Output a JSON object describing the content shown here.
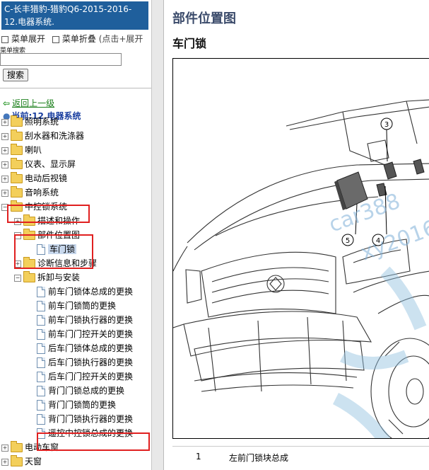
{
  "nav": {
    "title": "C-长丰猎豹-猎豹Q6-2015-2016- 12.电器系统.",
    "menu_expand": "菜单展开",
    "menu_collapse": "菜单折叠",
    "menu_hint": "(点击+展开",
    "search_label": "菜单搜索",
    "search_value": "",
    "search_button": "搜索",
    "back_link": "返回上一级",
    "current": "当前:12.电器系统",
    "tree": [
      {
        "label": "照明系统",
        "kind": "folder",
        "expander": "+"
      },
      {
        "label": "刮水器和洗涤器",
        "kind": "folder",
        "expander": "+"
      },
      {
        "label": "喇叭",
        "kind": "folder",
        "expander": "+"
      },
      {
        "label": "仪表、显示屏",
        "kind": "folder",
        "expander": "+"
      },
      {
        "label": "电动后视镜",
        "kind": "folder",
        "expander": "+"
      },
      {
        "label": "音响系统",
        "kind": "folder",
        "expander": "+"
      },
      {
        "label": "中控锁系统",
        "kind": "folder",
        "expander": "−"
      },
      {
        "label": "描述和操作",
        "kind": "folder",
        "expander": "+"
      },
      {
        "label": "部件位置图",
        "kind": "folder",
        "expander": "−"
      },
      {
        "label": "车门锁",
        "kind": "doc",
        "expander": ""
      },
      {
        "label": "诊断信息和步骤",
        "kind": "folder",
        "expander": "+"
      },
      {
        "label": "拆卸与安装",
        "kind": "folder",
        "expander": "−"
      },
      {
        "label": "前车门锁体总成的更换",
        "kind": "doc",
        "expander": ""
      },
      {
        "label": "前车门锁筒的更换",
        "kind": "doc",
        "expander": ""
      },
      {
        "label": "前车门锁执行器的更换",
        "kind": "doc",
        "expander": ""
      },
      {
        "label": "前车门门控开关的更换",
        "kind": "doc",
        "expander": ""
      },
      {
        "label": "后车门锁体总成的更换",
        "kind": "doc",
        "expander": ""
      },
      {
        "label": "后车门锁执行器的更换",
        "kind": "doc",
        "expander": ""
      },
      {
        "label": "后车门门控开关的更换",
        "kind": "doc",
        "expander": ""
      },
      {
        "label": "背门门锁总成的更换",
        "kind": "doc",
        "expander": ""
      },
      {
        "label": "背门门锁筒的更换",
        "kind": "doc",
        "expander": ""
      },
      {
        "label": "背门门锁执行器的更换",
        "kind": "doc",
        "expander": ""
      },
      {
        "label": "遥控中控锁总成的更换",
        "kind": "doc",
        "expander": ""
      },
      {
        "label": "电动车窗",
        "kind": "folder",
        "expander": "+"
      },
      {
        "label": "天窗",
        "kind": "folder",
        "expander": "+"
      }
    ]
  },
  "content": {
    "page_title": "部件位置图",
    "section_title": "车门锁",
    "callouts": [
      "3",
      "5",
      "4"
    ],
    "watermarks": [
      "car388",
      "xy2016"
    ],
    "legend": [
      {
        "num": "1",
        "text": "左前门锁块总成"
      }
    ]
  },
  "colors": {
    "title_bar": "#1f5f9c",
    "link_green": "#1a7f1a",
    "current_blue": "#1a3fa0",
    "highlight_red": "#e02020",
    "watermark": "#7fb0d8"
  }
}
